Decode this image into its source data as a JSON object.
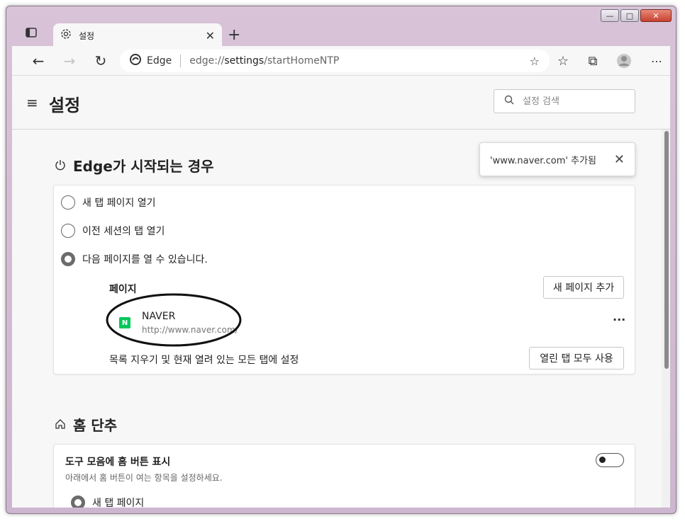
{
  "browser": {
    "tab_title": "설정",
    "address_brand": "Edge",
    "address_url_prefix": "edge://",
    "address_url_bold": "settings",
    "address_url_rest": "/startHomeNTP"
  },
  "settings": {
    "page_title": "설정",
    "search_placeholder": "설정 검색",
    "toast_message": "'www.naver.com' 추가됨",
    "startup": {
      "title": "Edge가 시작되는 경우",
      "options": [
        {
          "label": "새 탭 페이지 열기",
          "checked": false
        },
        {
          "label": "이전 세션의 탭 열기",
          "checked": false
        },
        {
          "label": "다음 페이지를 열 수 있습니다.",
          "checked": true
        }
      ],
      "pages_label": "페이지",
      "add_page_button": "새 페이지 추가",
      "page_item": {
        "name": "NAVER",
        "url": "http://www.naver.com/",
        "icon_letter": "N"
      },
      "more_label": "···",
      "clear_label": "목록 지우기 및 현재 열려 있는 모든 탭에 설정",
      "use_all_tabs_button": "열린 탭 모두 사용"
    },
    "home": {
      "title": "홈 단추",
      "toggle_title": "도구 모음에 홈 버튼 표시",
      "toggle_desc": "아래에서 홈 버튼이 여는 항목을 설정하세요.",
      "toggle_on": false,
      "option_newtab": "새 탭 페이지"
    }
  },
  "colors": {
    "naver_green": "#03c75a",
    "page_bg": "#f7f7f7",
    "frame": "#d8c3d8"
  }
}
